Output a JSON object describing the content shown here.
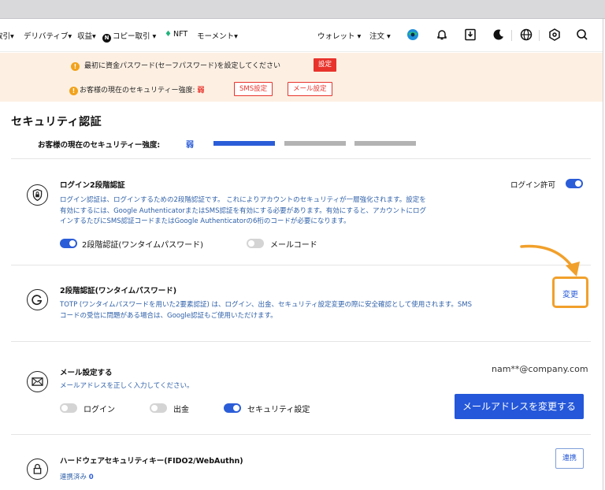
{
  "nav": {
    "items": [
      "取引▾",
      "デリバティブ▾",
      "収益▾",
      "コピー取引 ▾",
      "NFT",
      "モーメント▾"
    ],
    "right": [
      "ウォレット ▾",
      "注文 ▾"
    ]
  },
  "banner": {
    "line1": "最初に資金パスワード(セーフパスワード)を設定してください",
    "line1_button": "設定",
    "line2_prefix": "お客様の現在のセキュリティー強度: ",
    "line2_value": "弱",
    "sms_button": "SMS設定",
    "mail_button": "メール設定"
  },
  "page": {
    "title": "セキュリティ認証",
    "strength_label": "お客様の現在のセキュリティー強度:",
    "strength_value": "弱",
    "strength_level": 1,
    "strength_total": 3
  },
  "login2fa": {
    "title": "ログイン2段階認証",
    "desc": [
      "ログイン認証は、ログインするための2段階認証です。 これによりアカウントのセキュリティが一層強化されます。設定を",
      "有効にするには、Google AuthenticatorまたはSMS認証を有効にする必要があります。有効にすると、アカウントにログ",
      "インするたびにSMS認証コードまたはGoogle Authenticatorの6桁のコードが必要になります。"
    ],
    "permission_label": "ログイン許可",
    "permission_on": true,
    "otp_label": "2段階認証(ワンタイムパスワード)",
    "otp_on": true,
    "mailcode_label": "メールコード",
    "mailcode_on": false
  },
  "otp": {
    "title": "2段階認証(ワンタイムパスワード)",
    "desc": [
      "TOTP (ワンタイムパスワードを用いた2要素認証) は、ログイン、出金、セキュリティ設定変更の際に安全確認として使用されます。SMS",
      "コードの受信に問題がある場合は、Google認証もご使用いただけます。"
    ],
    "change_button": "変更"
  },
  "mail": {
    "title": "メール設定する",
    "desc": "メールアドレスを正しく入力してください。",
    "email": "nam**@company.com",
    "login_label": "ログイン",
    "login_on": false,
    "withdraw_label": "出金",
    "withdraw_on": false,
    "security_label": "セキュリティ設定",
    "security_on": true,
    "change_button": "メールアドレスを変更する"
  },
  "hardware": {
    "title": "ハードウェアセキュリティキー(FIDO2/WebAuthn)",
    "linked_label": "連携済み",
    "linked_count": "0",
    "link_button": "連携"
  },
  "colors": {
    "accent": "#2b5dd8",
    "danger": "#e8332c",
    "highlight": "#f1a02b",
    "banner_bg": "#fdf0e3"
  }
}
